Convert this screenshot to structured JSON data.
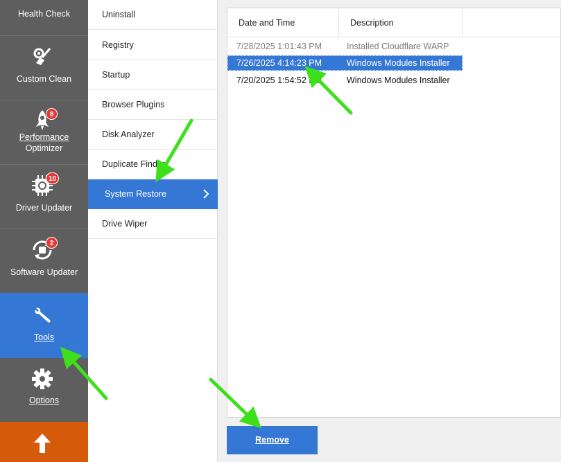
{
  "leftnav": {
    "items": [
      {
        "label": "Health Check",
        "badge": ""
      },
      {
        "label": "Custom Clean",
        "badge": ""
      },
      {
        "label": "Performance Optimizer",
        "label_line1": "Performance",
        "label_line2": "Optimizer",
        "badge": "8"
      },
      {
        "label": "Driver Updater",
        "badge": "10"
      },
      {
        "label": "Software Updater",
        "badge": "2"
      },
      {
        "label": "Tools",
        "badge": ""
      },
      {
        "label": "Options",
        "badge": ""
      }
    ]
  },
  "submenu": {
    "items": [
      {
        "label": "Uninstall"
      },
      {
        "label": "Registry"
      },
      {
        "label": "Startup"
      },
      {
        "label": "Browser Plugins"
      },
      {
        "label": "Disk Analyzer"
      },
      {
        "label": "Duplicate Finder"
      },
      {
        "label": "System Restore"
      },
      {
        "label": "Drive Wiper"
      }
    ]
  },
  "restore_table": {
    "columns": [
      "Date and Time",
      "Description"
    ],
    "rows": [
      {
        "date": "7/28/2025 1:01:43 PM",
        "description": "Installed Cloudflare WARP"
      },
      {
        "date": "7/26/2025 4:14:23 PM",
        "description": "Windows Modules Installer"
      },
      {
        "date": "7/20/2025 1:54:52 PM",
        "description": "Windows Modules Installer"
      }
    ]
  },
  "actions": {
    "remove_label": "Remove"
  },
  "colors": {
    "accent": "#3577d4",
    "nav_bg": "#5e5e5e",
    "upgrade": "#d55a0a",
    "annotation_arrow": "#3ee01c"
  }
}
